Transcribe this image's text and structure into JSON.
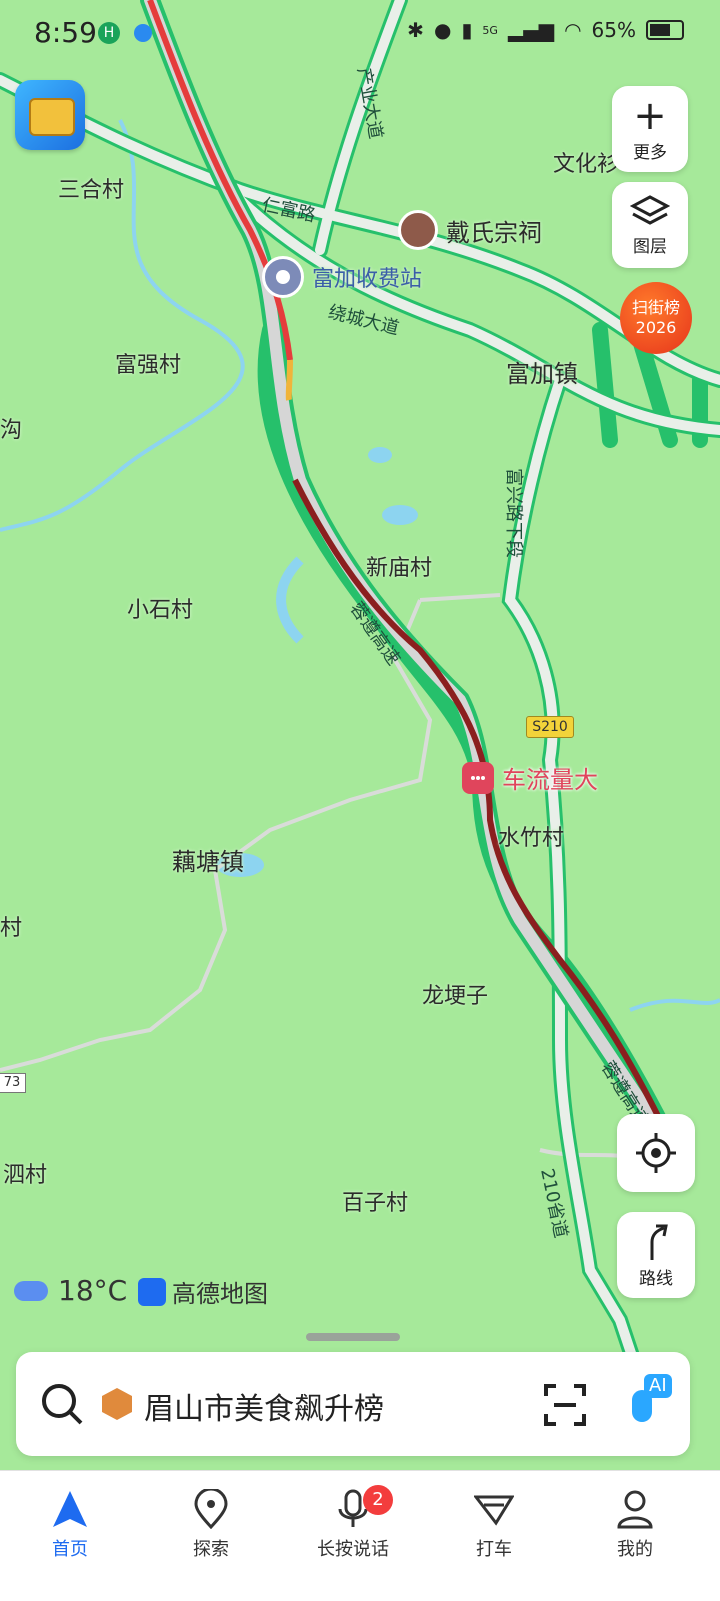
{
  "status_bar": {
    "time": "8:59",
    "battery": "65%",
    "network": "5G"
  },
  "map": {
    "places": [
      {
        "name": "三合村"
      },
      {
        "name": "富强村"
      },
      {
        "name": "沟"
      },
      {
        "name": "小石村"
      },
      {
        "name": "新庙村"
      },
      {
        "name": "藕塘镇"
      },
      {
        "name": "水竹村"
      },
      {
        "name": "村"
      },
      {
        "name": "龙埂子"
      },
      {
        "name": "泗村"
      },
      {
        "name": "百子村"
      },
      {
        "name": "富加镇"
      },
      {
        "name": "文化衫"
      }
    ],
    "roads": {
      "renfu": "仁富路",
      "industry": "产业大道",
      "ring": "绕城大道",
      "fuxing": "富兴路下段",
      "expressway": "蓉遵高速",
      "expressway_lower": "蓉遵高速",
      "provincial": "210省道",
      "s210": "S210",
      "r73": "73"
    },
    "pois": {
      "toll": "富加收费站",
      "temple": "戴氏宗祠",
      "traffic": "车流量大"
    },
    "weather": {
      "temp": "18°C"
    },
    "brand": "高德地图"
  },
  "controls": {
    "more": "更多",
    "layers": "图层",
    "hot_list": "扫街榜",
    "hot_year": "2026",
    "route": "路线"
  },
  "search": {
    "text": "眉山市美食飙升榜",
    "ai": "AI"
  },
  "nav": {
    "items": [
      {
        "label": "首页"
      },
      {
        "label": "探索"
      },
      {
        "label": "长按说话"
      },
      {
        "label": "打车"
      },
      {
        "label": "我的"
      }
    ],
    "badge": "2",
    "active": "首页",
    "accent": "#1e6bf0"
  },
  "colors": {
    "map_bg": "#a6e99a",
    "highway": "#26c06b",
    "congested": "#8b1f1f",
    "slow": "#e53c3c",
    "traffic_accent": "#e0455c"
  }
}
